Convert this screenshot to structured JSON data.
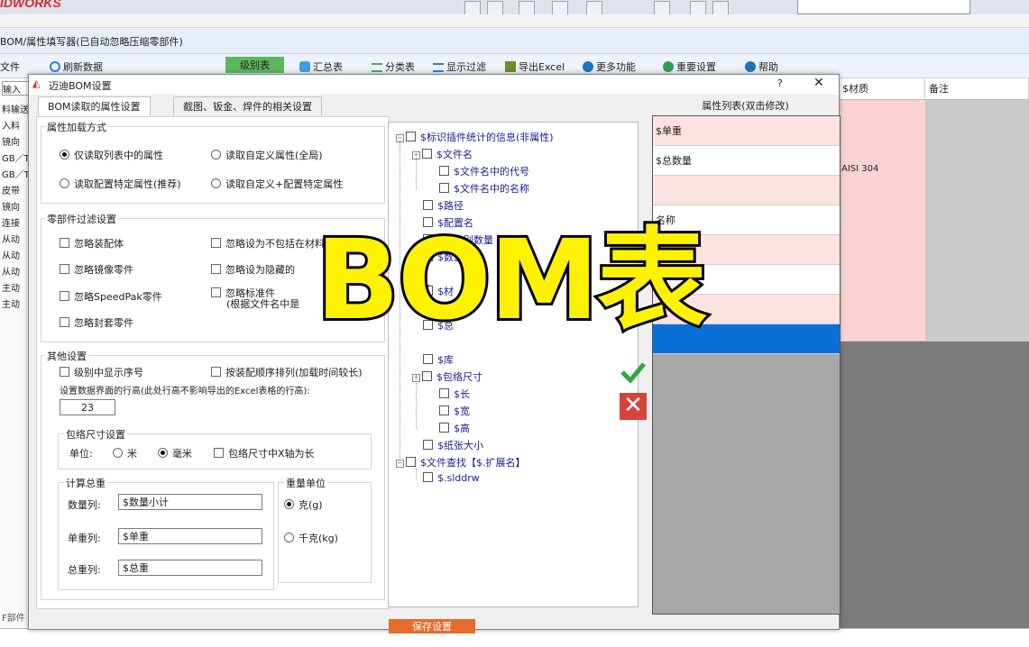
{
  "app": {
    "logo": "IDWORKS",
    "window_title": "BOM/属性填写器(已自动忽略压缩零部件)"
  },
  "toolbar": {
    "file": "文件",
    "refresh": "刷新数据",
    "level_table": "级别表",
    "summary": "汇总表",
    "category": "分类表",
    "filter": "显示过滤",
    "export_excel": "导出Excel",
    "more": "更多功能",
    "important_settings": "重要设置",
    "help": "帮助"
  },
  "background": {
    "left_input": "输入",
    "left_items": [
      "料输送",
      "入料",
      "镜向",
      "GB／T",
      "GB／T",
      "皮带",
      "镜向",
      "连接",
      "从动",
      "从动",
      "从动",
      "主动",
      "主动"
    ],
    "grid_headers": [
      "$材质",
      "备注"
    ],
    "material_value": "AISI 304",
    "status_text": "F部件"
  },
  "dialog": {
    "title": "迈迪BOM设置",
    "help_btn": "?",
    "close_btn": "✕",
    "tabs": [
      "BOM读取的属性设置",
      "截图、钣金、焊件的相关设置"
    ],
    "load_mode": {
      "label": "属性加载方式",
      "opt1": "仅读取列表中的属性",
      "opt2": "读取自定义属性(全局)",
      "opt3": "读取配置特定属性(推荐)",
      "opt4": "读取自定义+配置特定属性"
    },
    "part_filter": {
      "label": "零部件过滤设置",
      "ignore_assembly": "忽略装配体",
      "ignore_not_in_bom": "忽略设为不包括在材料明细表中的",
      "ignore_mirror": "忽略镜像零件",
      "ignore_hidden": "忽略设为隐藏的",
      "ignore_speedpak": "忽略SpeedPak零件",
      "ignore_standard": "忽略标准件",
      "ignore_standard_sub": "(根据文件名中是",
      "ignore_kit": "忽略封套零件"
    },
    "other": {
      "label": "其他设置",
      "show_seq": "级别中显示序号",
      "assembly_order": "按装配顺序排列(加载时间较长)",
      "row_height_label": "设置数据界面的行高(此处行高不影响导出的Excel表格的行高):",
      "row_height_value": "23"
    },
    "bbox": {
      "label": "包络尺寸设置",
      "unit_label": "单位:",
      "meter": "米",
      "mm": "毫米",
      "x_axis_long": "包络尺寸中X轴为长"
    },
    "weight": {
      "label": "计算总重",
      "qty_label": "数量列:",
      "qty_value": "$数量小计",
      "unit_weight_label": "单重列:",
      "unit_weight_value": "$单重",
      "total_label": "总重列:",
      "total_value": "$总重"
    },
    "weight_unit": {
      "label": "重量单位",
      "gram": "克(g)",
      "kg": "千克(kg)"
    },
    "tree": [
      "$标识插件统计的信息(非属性)",
      "$文件名",
      "$文件名中的代号",
      "$文件名中的名称",
      "$路径",
      "$配置名",
      "$本级别数量",
      "$数量小计",
      "$材",
      "$单",
      "$总",
      "$库",
      "$包络尺寸",
      "$长",
      "$宽",
      "$高",
      "$纸张大小",
      "$文件查找【$.扩展名】",
      "$.slddrw"
    ],
    "prop_list": {
      "title": "属性列表(双击修改)",
      "rows": [
        "$单重",
        "$总数量",
        "",
        "名称",
        "",
        "",
        "",
        ""
      ]
    },
    "save_button": "保存设置"
  },
  "overlay_text": "BOM表",
  "colors": {
    "accent_green": "#5cb85c",
    "pink_row": "#fde2e2",
    "selected_blue": "#0a6fd8",
    "overlay_yellow": "#fff200",
    "close_red": "#d9423a",
    "save_orange": "#e56c2c"
  }
}
